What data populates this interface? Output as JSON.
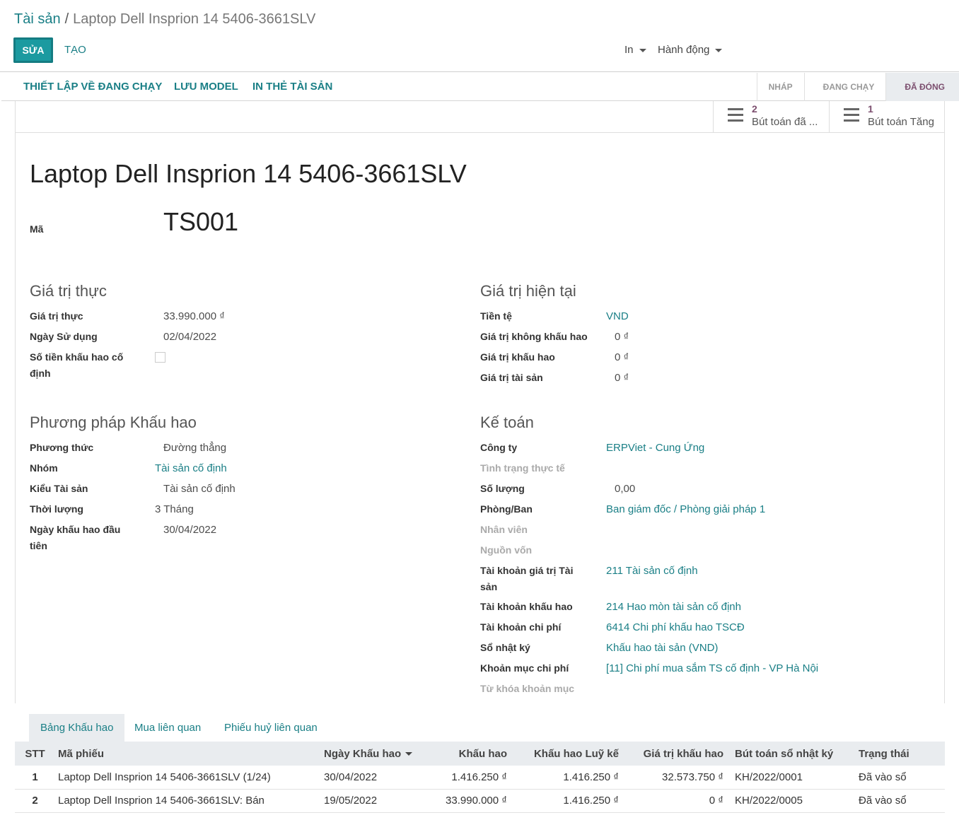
{
  "breadcrumb": {
    "root": "Tài sản",
    "separator": "/",
    "current": "Laptop Dell Insprion 14 5406-3661SLV"
  },
  "toolbar": {
    "edit_label": "SỬA",
    "create_label": "TẠO",
    "print_label": "In",
    "action_label": "Hành động"
  },
  "statusbar": {
    "buttons": [
      "THIẾT LẬP VỀ ĐANG CHẠY",
      "LƯU MODEL",
      "IN THẺ TÀI SẢN"
    ],
    "stages": [
      "NHÁP",
      "ĐANG CHẠY",
      "ĐÃ ĐÓNG"
    ],
    "active_stage": "ĐÃ ĐÓNG"
  },
  "smart_buttons": [
    {
      "count": "2",
      "label": "Bút toán đã ..."
    },
    {
      "count": "1",
      "label": "Bút toán Tăng"
    }
  ],
  "record": {
    "name": "Laptop Dell Insprion 14 5406-3661SLV",
    "code_label": "Mã",
    "code": "TS001"
  },
  "original_value": {
    "title": "Giá trị thực",
    "fields": [
      {
        "label": "Giá trị thực",
        "value": "33.990.000 ₫"
      },
      {
        "label": "Ngày Sử dụng",
        "value": "02/04/2022"
      },
      {
        "label": "Số tiền khấu hao cố định",
        "value": ""
      }
    ]
  },
  "current_value": {
    "title": "Giá trị hiện tại",
    "fields": [
      {
        "label": "Tiền tệ",
        "value": "VND"
      },
      {
        "label": "Giá trị không khấu hao",
        "value": "0 ₫"
      },
      {
        "label": "Giá trị khấu hao",
        "value": "0 ₫"
      },
      {
        "label": "Giá trị tài sản",
        "value": "0 ₫"
      }
    ]
  },
  "method": {
    "title": "Phương pháp Khấu hao",
    "fields": [
      {
        "label": "Phương thức",
        "value": "Đường thẳng"
      },
      {
        "label": "Nhóm",
        "value": "Tài sản cố định"
      },
      {
        "label": "Kiểu Tài sản",
        "value": "Tài sản cố định"
      },
      {
        "label": "Thời lượng",
        "value": "3",
        "unit": "Tháng"
      },
      {
        "label": "Ngày khấu hao đầu tiên",
        "value": "30/04/2022"
      }
    ]
  },
  "accounting": {
    "title": "Kế toán",
    "fields": [
      {
        "label": "Công ty",
        "value": "ERPViet - Cung Ứng"
      },
      {
        "label": "Tình trạng thực tế",
        "value": ""
      },
      {
        "label": "Số lượng",
        "value": "0,00"
      },
      {
        "label": "Phòng/Ban",
        "value": "Ban giám đốc / Phòng giải pháp 1"
      },
      {
        "label": "Nhân viên",
        "value": ""
      },
      {
        "label": "Nguồn vốn",
        "value": ""
      },
      {
        "label": "Tài khoản giá trị Tài sản",
        "value": "211 Tài sản cố định"
      },
      {
        "label": "Tài khoản khấu hao",
        "value": "214 Hao mòn tài sản cố định"
      },
      {
        "label": "Tài khoản chi phí",
        "value": "6414 Chi phí khấu hao TSCĐ"
      },
      {
        "label": "Sổ nhật ký",
        "value": "Khấu hao tài sản (VND)"
      },
      {
        "label": "Khoản mục chi phí",
        "value": "[11] Chi phí mua sắm TS cố định - VP Hà Nội"
      },
      {
        "label": "Từ khóa khoản mục",
        "value": ""
      }
    ]
  },
  "tabs": [
    "Bảng Khấu hao",
    "Mua liên quan",
    "Phiếu huỷ liên quan"
  ],
  "table": {
    "headers": [
      "STT",
      "Mã phiếu",
      "Ngày Khấu hao",
      "Khấu hao",
      "Khấu hao Luỹ kế",
      "Giá trị khấu hao",
      "Bút toán sổ nhật ký",
      "Trạng thái"
    ],
    "rows": [
      {
        "stt": "1",
        "name": "Laptop Dell Insprion 14 5406-3661SLV (1/24)",
        "date": "30/04/2022",
        "amount": "1.416.250 ₫",
        "accum": "1.416.250 ₫",
        "remaining": "32.573.750 ₫",
        "move": "KH/2022/0001",
        "state": "Đã vào sổ"
      },
      {
        "stt": "2",
        "name": "Laptop Dell Insprion 14 5406-3661SLV: Bán",
        "date": "19/05/2022",
        "amount": "33.990.000 ₫",
        "accum": "1.416.250 ₫",
        "remaining": "0 ₫",
        "move": "KH/2022/0005",
        "state": "Đã vào sổ"
      }
    ]
  }
}
